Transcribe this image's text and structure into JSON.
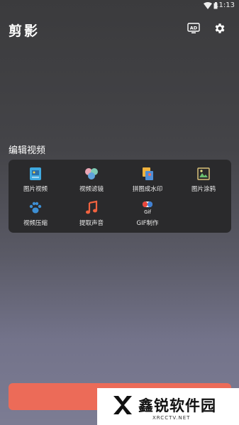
{
  "status_bar": {
    "time": "11:13",
    "icons": [
      "wifi-icon",
      "battery-icon"
    ]
  },
  "app_bar": {
    "title": "剪影",
    "actions": [
      "ad-icon",
      "gear-icon"
    ],
    "ad_label": "AD"
  },
  "section": {
    "title": "编辑视频"
  },
  "tools": [
    {
      "label": "图片视频",
      "icon": "photo-video-icon"
    },
    {
      "label": "视频滤镜",
      "icon": "video-filter-icon"
    },
    {
      "label": "拼图成水印",
      "icon": "puzzle-watermark-icon"
    },
    {
      "label": "图片涂鸦",
      "icon": "picture-doodle-icon"
    },
    {
      "label": "视频压缩",
      "icon": "video-compress-icon"
    },
    {
      "label": "提取声音",
      "icon": "extract-audio-icon"
    },
    {
      "label": "GIF制作",
      "icon": "gif-maker-icon",
      "icon_text": "Gif"
    }
  ],
  "watermark": {
    "text": "鑫锐软件园",
    "url": "XRCCTV.NET"
  },
  "colors": {
    "accent": "#ec6b58",
    "panel": "#2a2a2c"
  }
}
